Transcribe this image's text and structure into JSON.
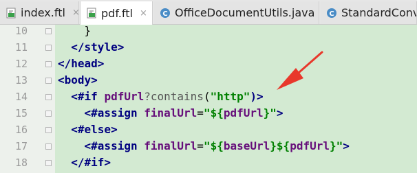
{
  "tabs": [
    {
      "label": "index.ftl",
      "icon": "ftl-file-icon",
      "active": false
    },
    {
      "label": "pdf.ftl",
      "icon": "ftl-file-icon",
      "active": true
    },
    {
      "label": "OfficeDocumentUtils.java",
      "icon": "java-class-icon",
      "active": false
    },
    {
      "label": "StandardConve",
      "icon": "java-class-icon",
      "active": false
    }
  ],
  "close_glyph": "×",
  "editor": {
    "background": "#d3ead2",
    "lines": [
      {
        "number": "10",
        "segments": [
          {
            "t": "    }",
            "c": "plain"
          }
        ]
      },
      {
        "number": "11",
        "segments": [
          {
            "t": "  </style>",
            "c": "tag"
          }
        ]
      },
      {
        "number": "12",
        "segments": [
          {
            "t": "</head>",
            "c": "tag"
          }
        ]
      },
      {
        "number": "13",
        "segments": [
          {
            "t": "<body>",
            "c": "tag"
          }
        ]
      },
      {
        "number": "14",
        "segments": [
          {
            "t": "  <#if ",
            "c": "kw"
          },
          {
            "t": "pdfUrl",
            "c": "var"
          },
          {
            "t": "?contains",
            "c": "fn"
          },
          {
            "t": "(",
            "c": "plain"
          },
          {
            "t": "\"http\"",
            "c": "str"
          },
          {
            "t": ")>",
            "c": "kw"
          }
        ]
      },
      {
        "number": "15",
        "segments": [
          {
            "t": "    <#assign ",
            "c": "kw"
          },
          {
            "t": "finalUrl",
            "c": "var"
          },
          {
            "t": "=",
            "c": "plain"
          },
          {
            "t": "\"${",
            "c": "str"
          },
          {
            "t": "pdfUrl",
            "c": "var"
          },
          {
            "t": "}\"",
            "c": "str"
          },
          {
            "t": ">",
            "c": "kw"
          }
        ]
      },
      {
        "number": "16",
        "segments": [
          {
            "t": "  <#else>",
            "c": "kw"
          }
        ]
      },
      {
        "number": "17",
        "segments": [
          {
            "t": "    <#assign ",
            "c": "kw"
          },
          {
            "t": "finalUrl",
            "c": "var"
          },
          {
            "t": "=",
            "c": "plain"
          },
          {
            "t": "\"${",
            "c": "str"
          },
          {
            "t": "baseUrl",
            "c": "var"
          },
          {
            "t": "}${",
            "c": "str"
          },
          {
            "t": "pdfUrl",
            "c": "var"
          },
          {
            "t": "}\"",
            "c": "str"
          },
          {
            "t": ">",
            "c": "kw"
          }
        ]
      },
      {
        "number": "18",
        "segments": [
          {
            "t": "  </#if>",
            "c": "kw"
          }
        ]
      }
    ]
  },
  "annotation": {
    "type": "red-arrow",
    "color": "#e8382b"
  }
}
